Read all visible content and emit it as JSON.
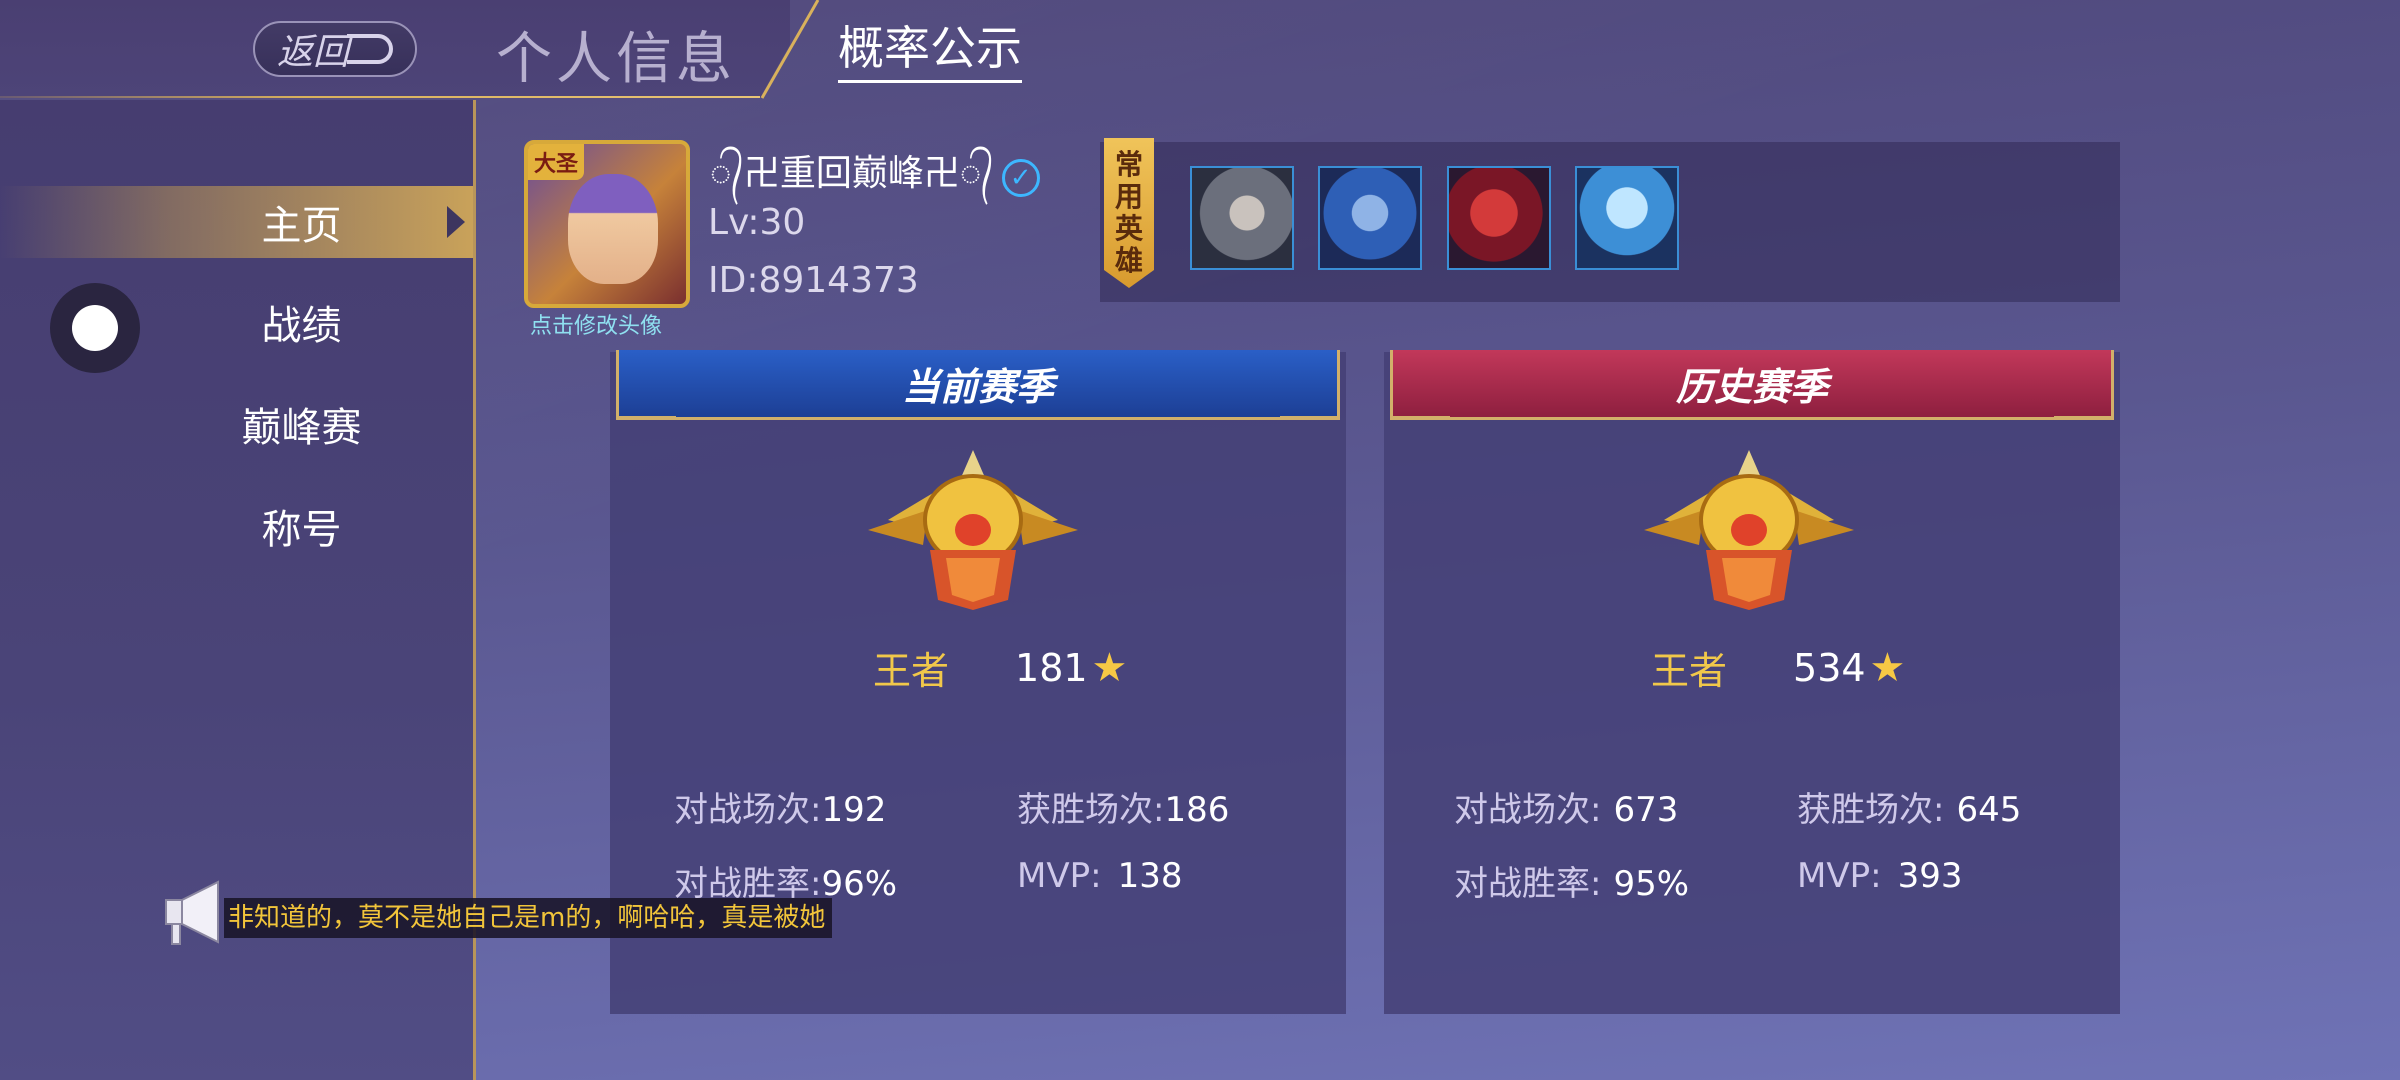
{
  "header": {
    "back_label": "返回",
    "tab_profile": "个人信息",
    "tab_probability": "概率公示"
  },
  "sidebar": {
    "items": [
      {
        "label": "主页",
        "active": true
      },
      {
        "label": "战绩",
        "active": false
      },
      {
        "label": "巅峰赛",
        "active": false
      },
      {
        "label": "称号",
        "active": false
      }
    ]
  },
  "profile": {
    "avatar_badge": "大圣",
    "avatar_caption": "点击修改头像",
    "name": "᭄卍重回巅峰卍᭄",
    "level": "Lv:30",
    "id": "ID:8914373",
    "verified_icon": "check-circle-icon"
  },
  "heroes": {
    "label": [
      "常",
      "用",
      "英",
      "雄"
    ],
    "slots": [
      {
        "icon": "hero-portrait-grey-hair"
      },
      {
        "icon": "hero-portrait-blue-elf"
      },
      {
        "icon": "hero-portrait-red-hair"
      },
      {
        "icon": "hero-portrait-white-hair"
      }
    ]
  },
  "seasons": {
    "current": {
      "title": "当前赛季",
      "rank": "王者",
      "stars": "181",
      "battles_label": "对战场次:",
      "battles": "192",
      "wins_label": "获胜场次:",
      "wins": "186",
      "winrate_label": "对战胜率:",
      "winrate": "96%",
      "mvp_label": "MVP:",
      "mvp": "138"
    },
    "history": {
      "title": "历史赛季",
      "rank": "王者",
      "stars": "534",
      "battles_label": "对战场次:",
      "battles": "673",
      "wins_label": "获胜场次:",
      "wins": "645",
      "winrate_label": "对战胜率:",
      "winrate": "95%",
      "mvp_label": "MVP:",
      "mvp": "393"
    }
  },
  "broadcast": {
    "text": "非知道的，莫不是她自己是m的，啊哈哈，真是被她"
  },
  "colors": {
    "accent_gold": "#d9b15c",
    "rank_gold": "#f1c84a",
    "current_banner": "#2a5fc7",
    "history_banner": "#c2385a"
  }
}
